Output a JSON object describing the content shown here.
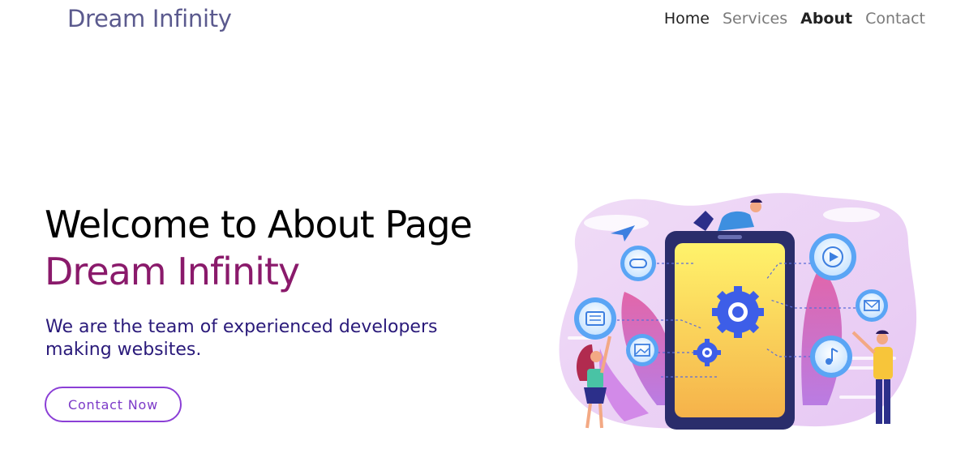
{
  "nav": {
    "brand": "Dream Infinity",
    "links": [
      {
        "label": "Home"
      },
      {
        "label": "Services"
      },
      {
        "label": "About"
      },
      {
        "label": "Contact"
      }
    ]
  },
  "hero": {
    "title": "Welcome to About Page",
    "brand": "Dream Infinity",
    "subtitle": "We are the team of experienced developers making websites.",
    "cta_label": "Contact Now"
  },
  "colors": {
    "brand_text": "#5b5a8e",
    "accent": "#8a1a6b",
    "subtitle": "#2a1a7a",
    "cta_border": "#8b3fd6"
  },
  "illustration": {
    "icons": [
      "paper-plane-icon",
      "gamepad-icon",
      "chat-icon",
      "image-icon",
      "play-icon",
      "mail-icon",
      "music-note-icon",
      "gear-icon"
    ]
  }
}
